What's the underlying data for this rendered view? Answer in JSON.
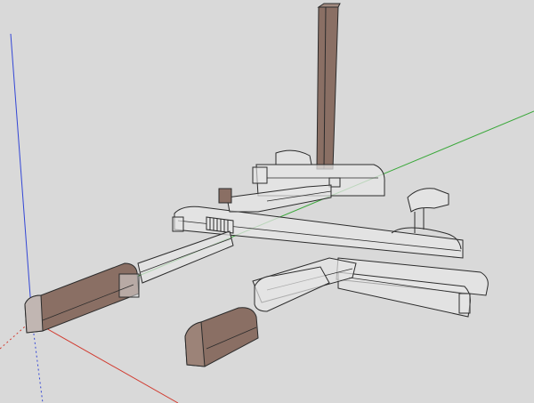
{
  "viewport": {
    "background": "#d9d9d9",
    "axis_colors": {
      "red": "#d13a2f",
      "green": "#3aa83a",
      "blue": "#3346d6"
    },
    "glass_fill": "#e6e6e6",
    "glass_stroke": "#2b2b2b",
    "solid_fill": "#8a6f64",
    "solid_fill_dark": "#6e564c"
  }
}
